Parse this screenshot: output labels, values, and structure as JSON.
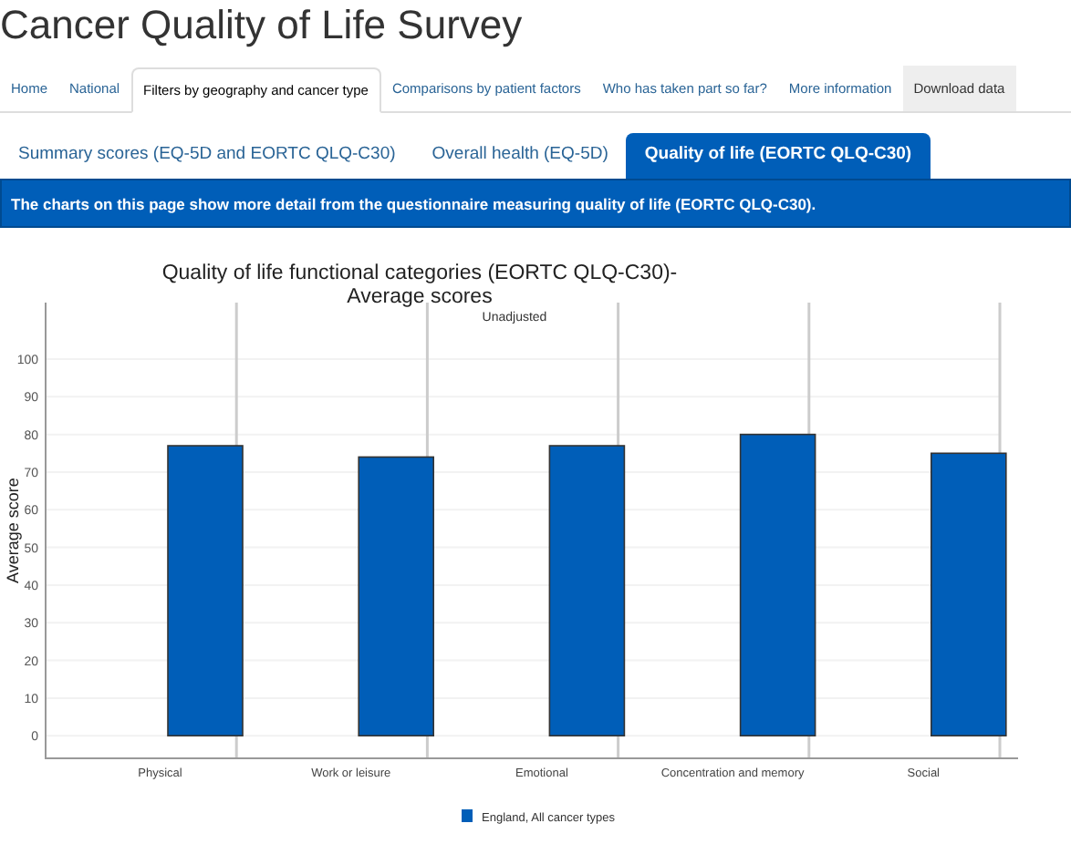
{
  "page_title": "Cancer Quality of Life Survey",
  "tabs": [
    {
      "label": "Home",
      "selected": false,
      "kind": "link"
    },
    {
      "label": "National",
      "selected": false,
      "kind": "link"
    },
    {
      "label": "Filters by geography and cancer type",
      "selected": true,
      "kind": "link"
    },
    {
      "label": "Comparisons by patient factors",
      "selected": false,
      "kind": "link"
    },
    {
      "label": "Who has taken part so far?",
      "selected": false,
      "kind": "link"
    },
    {
      "label": "More information",
      "selected": false,
      "kind": "link"
    },
    {
      "label": "Download data",
      "selected": false,
      "kind": "download"
    }
  ],
  "subtabs": [
    {
      "label": "Summary scores (EQ-5D and EORTC QLQ-C30)",
      "selected": false
    },
    {
      "label": "Overall health (EQ-5D)",
      "selected": false
    },
    {
      "label": "Quality of life (EORTC QLQ-C30)",
      "selected": true
    }
  ],
  "banner": "The charts on this page show more detail from the questionnaire measuring quality of life (EORTC QLQ-C30).",
  "chart": {
    "chart_data": {
      "type": "bar",
      "title": "Quality of life functional categories (EORTC QLQ-C30)-\nAverage scores",
      "subtitle": "Unadjusted",
      "ylabel": "Average score",
      "categories": [
        "Physical",
        "Work or leisure",
        "Emotional",
        "Concentration and memory",
        "Social"
      ],
      "series": [
        {
          "name": "England, All cancer types",
          "color": "#005eb8",
          "values": [
            77,
            74,
            77,
            80,
            75
          ]
        }
      ],
      "ylim": [
        -6,
        115
      ],
      "grid": true,
      "yticks": [
        0,
        10,
        20,
        30,
        40,
        50,
        60,
        70,
        80,
        90,
        100
      ]
    }
  }
}
